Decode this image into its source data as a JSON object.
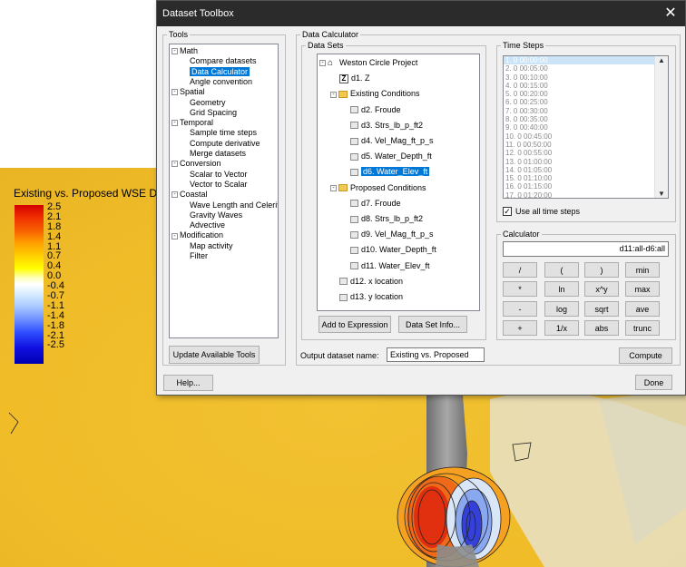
{
  "dialog": {
    "title": "Dataset Toolbox",
    "tools_group": "Tools",
    "tools_tree": [
      {
        "label": "Math",
        "expander": "-"
      },
      {
        "label": "Compare datasets"
      },
      {
        "label": "Data Calculator",
        "selected": true
      },
      {
        "label": "Angle convention"
      },
      {
        "label": "Spatial",
        "expander": "-"
      },
      {
        "label": "Geometry"
      },
      {
        "label": "Grid Spacing"
      },
      {
        "label": "Temporal",
        "expander": "-"
      },
      {
        "label": "Sample time steps"
      },
      {
        "label": "Compute derivative"
      },
      {
        "label": "Merge datasets"
      },
      {
        "label": "Conversion",
        "expander": "-"
      },
      {
        "label": "Scalar to Vector"
      },
      {
        "label": "Vector to Scalar"
      },
      {
        "label": "Coastal",
        "expander": "-"
      },
      {
        "label": "Wave Length and Celerity"
      },
      {
        "label": "Gravity Waves"
      },
      {
        "label": "Advective"
      },
      {
        "label": "Modification",
        "expander": "-"
      },
      {
        "label": "Map activity"
      },
      {
        "label": "Filter"
      }
    ],
    "update_tools_button": "Update Available Tools",
    "help_button": "Help...",
    "data_calculator_group": "Data Calculator",
    "data_sets_group": "Data Sets",
    "datasets_tree": [
      {
        "label": "Weston Circle Project",
        "icon": "project",
        "expander": "-"
      },
      {
        "label": "d1. Z",
        "icon": "z"
      },
      {
        "label": "Existing Conditions",
        "icon": "folder",
        "expander": "-"
      },
      {
        "label": "d2. Froude",
        "icon": "dataset"
      },
      {
        "label": "d3. Strs_lb_p_ft2",
        "icon": "dataset"
      },
      {
        "label": "d4. Vel_Mag_ft_p_s",
        "icon": "dataset"
      },
      {
        "label": "d5. Water_Depth_ft",
        "icon": "dataset"
      },
      {
        "label": "d6. Water_Elev_ft",
        "icon": "dataset",
        "selected": true
      },
      {
        "label": "Proposed Conditions",
        "icon": "folder",
        "expander": "-"
      },
      {
        "label": "d7. Froude",
        "icon": "dataset"
      },
      {
        "label": "d8. Strs_lb_p_ft2",
        "icon": "dataset"
      },
      {
        "label": "d9. Vel_Mag_ft_p_s",
        "icon": "dataset"
      },
      {
        "label": "d10. Water_Depth_ft",
        "icon": "dataset"
      },
      {
        "label": "d11. Water_Elev_ft",
        "icon": "dataset"
      },
      {
        "label": "d12. x location",
        "icon": "dataset"
      },
      {
        "label": "d13. y location",
        "icon": "dataset"
      }
    ],
    "add_to_expression_button": "Add to Expression",
    "data_set_info_button": "Data Set Info...",
    "output_name_label": "Output dataset name:",
    "output_name_value": "Existing vs. Proposed",
    "time_steps_group": "Time Steps",
    "time_steps": [
      "1. 0 00:00:00",
      "2. 0 00:05:00",
      "3. 0 00:10:00",
      "4. 0 00:15:00",
      "5. 0 00:20:00",
      "6. 0 00:25:00",
      "7. 0 00:30:00",
      "8. 0 00:35:00",
      "9. 0 00:40:00",
      "10. 0 00:45:00",
      "11. 0 00:50:00",
      "12. 0 00:55:00",
      "13. 0 01:00:00",
      "14. 0 01:05:00",
      "15. 0 01:10:00",
      "16. 0 01:15:00",
      "17. 0 01:20:00"
    ],
    "use_all_time_steps_label": "Use all time steps",
    "use_all_time_steps_checked": true,
    "calculator_group": "Calculator",
    "expression": "d11:all-d6:all",
    "calc_buttons": [
      [
        "/",
        "(",
        ")",
        "min"
      ],
      [
        "*",
        "ln",
        "x^y",
        "max"
      ],
      [
        "-",
        "log",
        "sqrt",
        "ave"
      ],
      [
        "+",
        "1/x",
        "abs",
        "trunc"
      ]
    ],
    "compute_button": "Compute",
    "done_button": "Done"
  },
  "legend": {
    "title": "Existing vs. Proposed WSE Diff",
    "labels": [
      "2.5",
      "2.1",
      "1.8",
      "1.4",
      "1.1",
      "0.7",
      "0.4",
      "0.0",
      "-0.4",
      "-0.7",
      "-1.1",
      "-1.4",
      "-1.8",
      "-2.1",
      "-2.5"
    ]
  }
}
